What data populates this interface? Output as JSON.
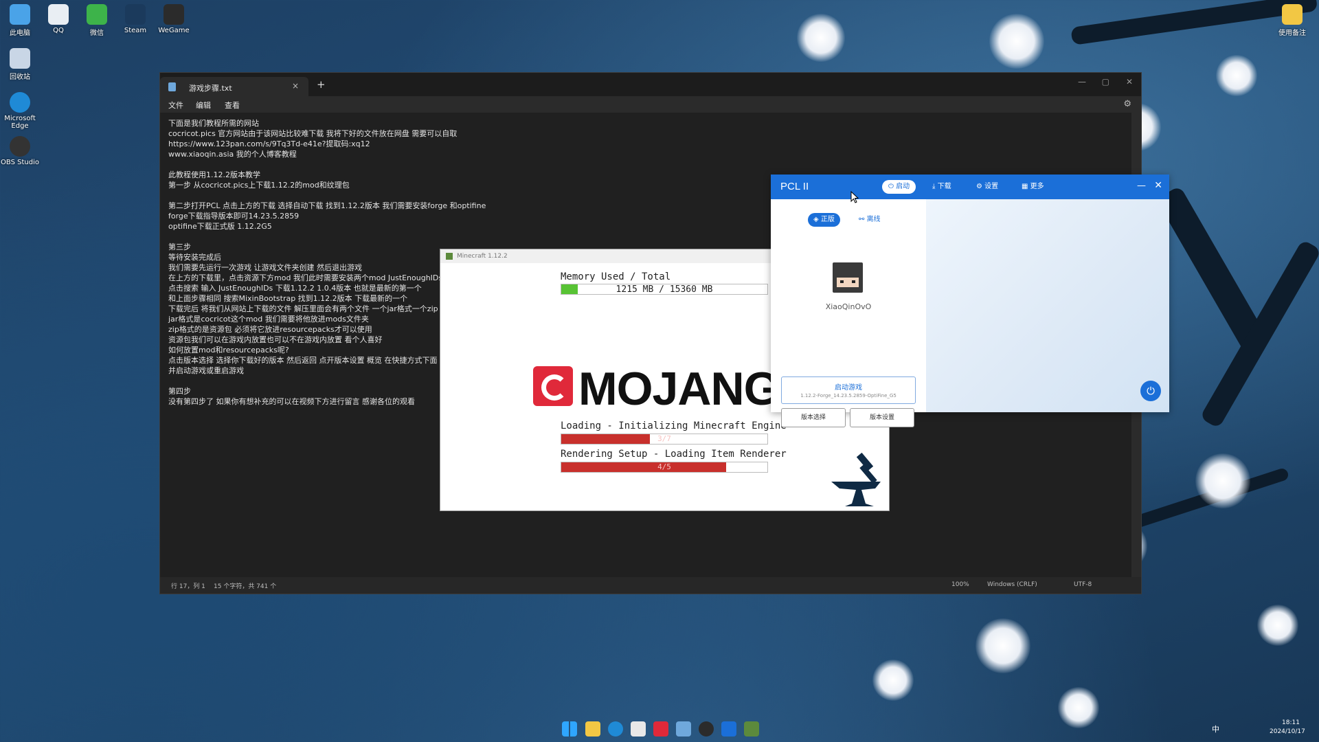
{
  "desktop": {
    "icons_top": [
      {
        "label": "此电脑",
        "color": "#4aa3e8"
      },
      {
        "label": "QQ",
        "color": "#e9eef3"
      },
      {
        "label": "微信",
        "color": "#3db34a"
      },
      {
        "label": "Steam",
        "color": "#1b3a5c"
      },
      {
        "label": "WeGame",
        "color": "#2b2b2b"
      }
    ],
    "icons_left": [
      {
        "label": "回收站",
        "color": "#c9d6e6"
      },
      {
        "label": "Microsoft Edge",
        "color": "#1f8ad6"
      },
      {
        "label": "OBS Studio",
        "color": "#333333"
      }
    ],
    "folder_top_right": {
      "label": "使用备注",
      "color": "#f2c744"
    }
  },
  "notepad": {
    "tab_title": "游戏步骤.txt",
    "tab_close": "×",
    "new_tab": "+",
    "menu": [
      "文件",
      "编辑",
      "查看"
    ],
    "lines": [
      "下面是我们教程所需的网站",
      "cocricot.pics 官方网站由于该网站比较难下载 我将下好的文件放在网盘 需要可以自取",
      "https://www.123pan.com/s/9Tq3Td-e41e?提取码:xq12",
      "www.xiaoqin.asia 我的个人博客教程",
      "",
      "此教程使用1.12.2版本教学",
      "第一步 从cocricot.pics上下载1.12.2的mod和纹理包",
      "",
      "第二步打开PCL 点击上方的下载 选择自动下载 找到1.12.2版本 我们需要安装forge 和optifine",
      "forge下载指导版本即可14.23.5.2859",
      "optifine下载正式版 1.12.2G5",
      "",
      "第三步",
      "等待安装完成后",
      "我们需要先运行一次游戏 让游戏文件夹创建 然后退出游戏",
      "在上方的下载里，点击资源下方mod 我们此时需要安装两个mod JustEnoughIDs",
      "点击搜索 输入 JustEnoughIDs 下载1.12.2 1.0.4版本 也就是最新的第一个",
      "和上面步骤相同 搜索MixinBootstrap 找到1.12.2版本 下载最新的一个",
      "下载完后 将我们从网站上下载的文件 解压里面会有两个文件 一个jar格式一个zip",
      "jar格式是cocricot这个mod 我们需要将他放进mods文件夹",
      "zip格式的是资源包 必须将它放进resourcepacks才可以使用",
      "资源包我们可以在游戏内放置也可以不在游戏内放置 看个人喜好",
      "如何放置mod和resourcepacks呢?",
      "点击版本选择 选择你下载好的版本 然后返回 点开版本设置 概览 在快捷方式下面",
      "并启动游戏或重启游戏",
      "",
      "第四步",
      "没有第四步了 如果你有想补充的可以在视频下方进行留言 感谢各位的观看"
    ],
    "status": {
      "position": "行 17，列 1",
      "chars": "15 个字符，共 741 个",
      "zoom": "100%",
      "eol": "Windows (CRLF)",
      "encoding": "UTF-8"
    }
  },
  "minecraft": {
    "window_title": "Minecraft 1.12.2",
    "memory_label": "Memory Used / Total",
    "memory_value": "1215 MB / 15360 MB",
    "memory_fraction": 0.079,
    "logo_text": "MOJANG",
    "loading1_label": "Loading - Initializing Minecraft Engine",
    "loading1_progress": "3/7",
    "loading1_fraction": 0.43,
    "loading2_label": "Rendering Setup - Loading Item Renderer",
    "loading2_progress": "4/5",
    "loading2_fraction": 0.8
  },
  "pcl": {
    "brand": "PCL II",
    "nav": [
      "启动",
      "下载",
      "设置",
      "更多"
    ],
    "account_tabs": [
      "正版",
      "离线"
    ],
    "username": "XiaoQinOvO",
    "launch_label": "启动游戏",
    "launch_version": "1.12.2-Forge_14.23.5.2859-OptiFine_G5",
    "version_select": "版本选择",
    "version_settings": "版本设置",
    "accent": "#1b6fd8"
  },
  "taskbar": {
    "tray_lang": "中",
    "tray_time": "18:11",
    "tray_date": "2024/10/17"
  }
}
